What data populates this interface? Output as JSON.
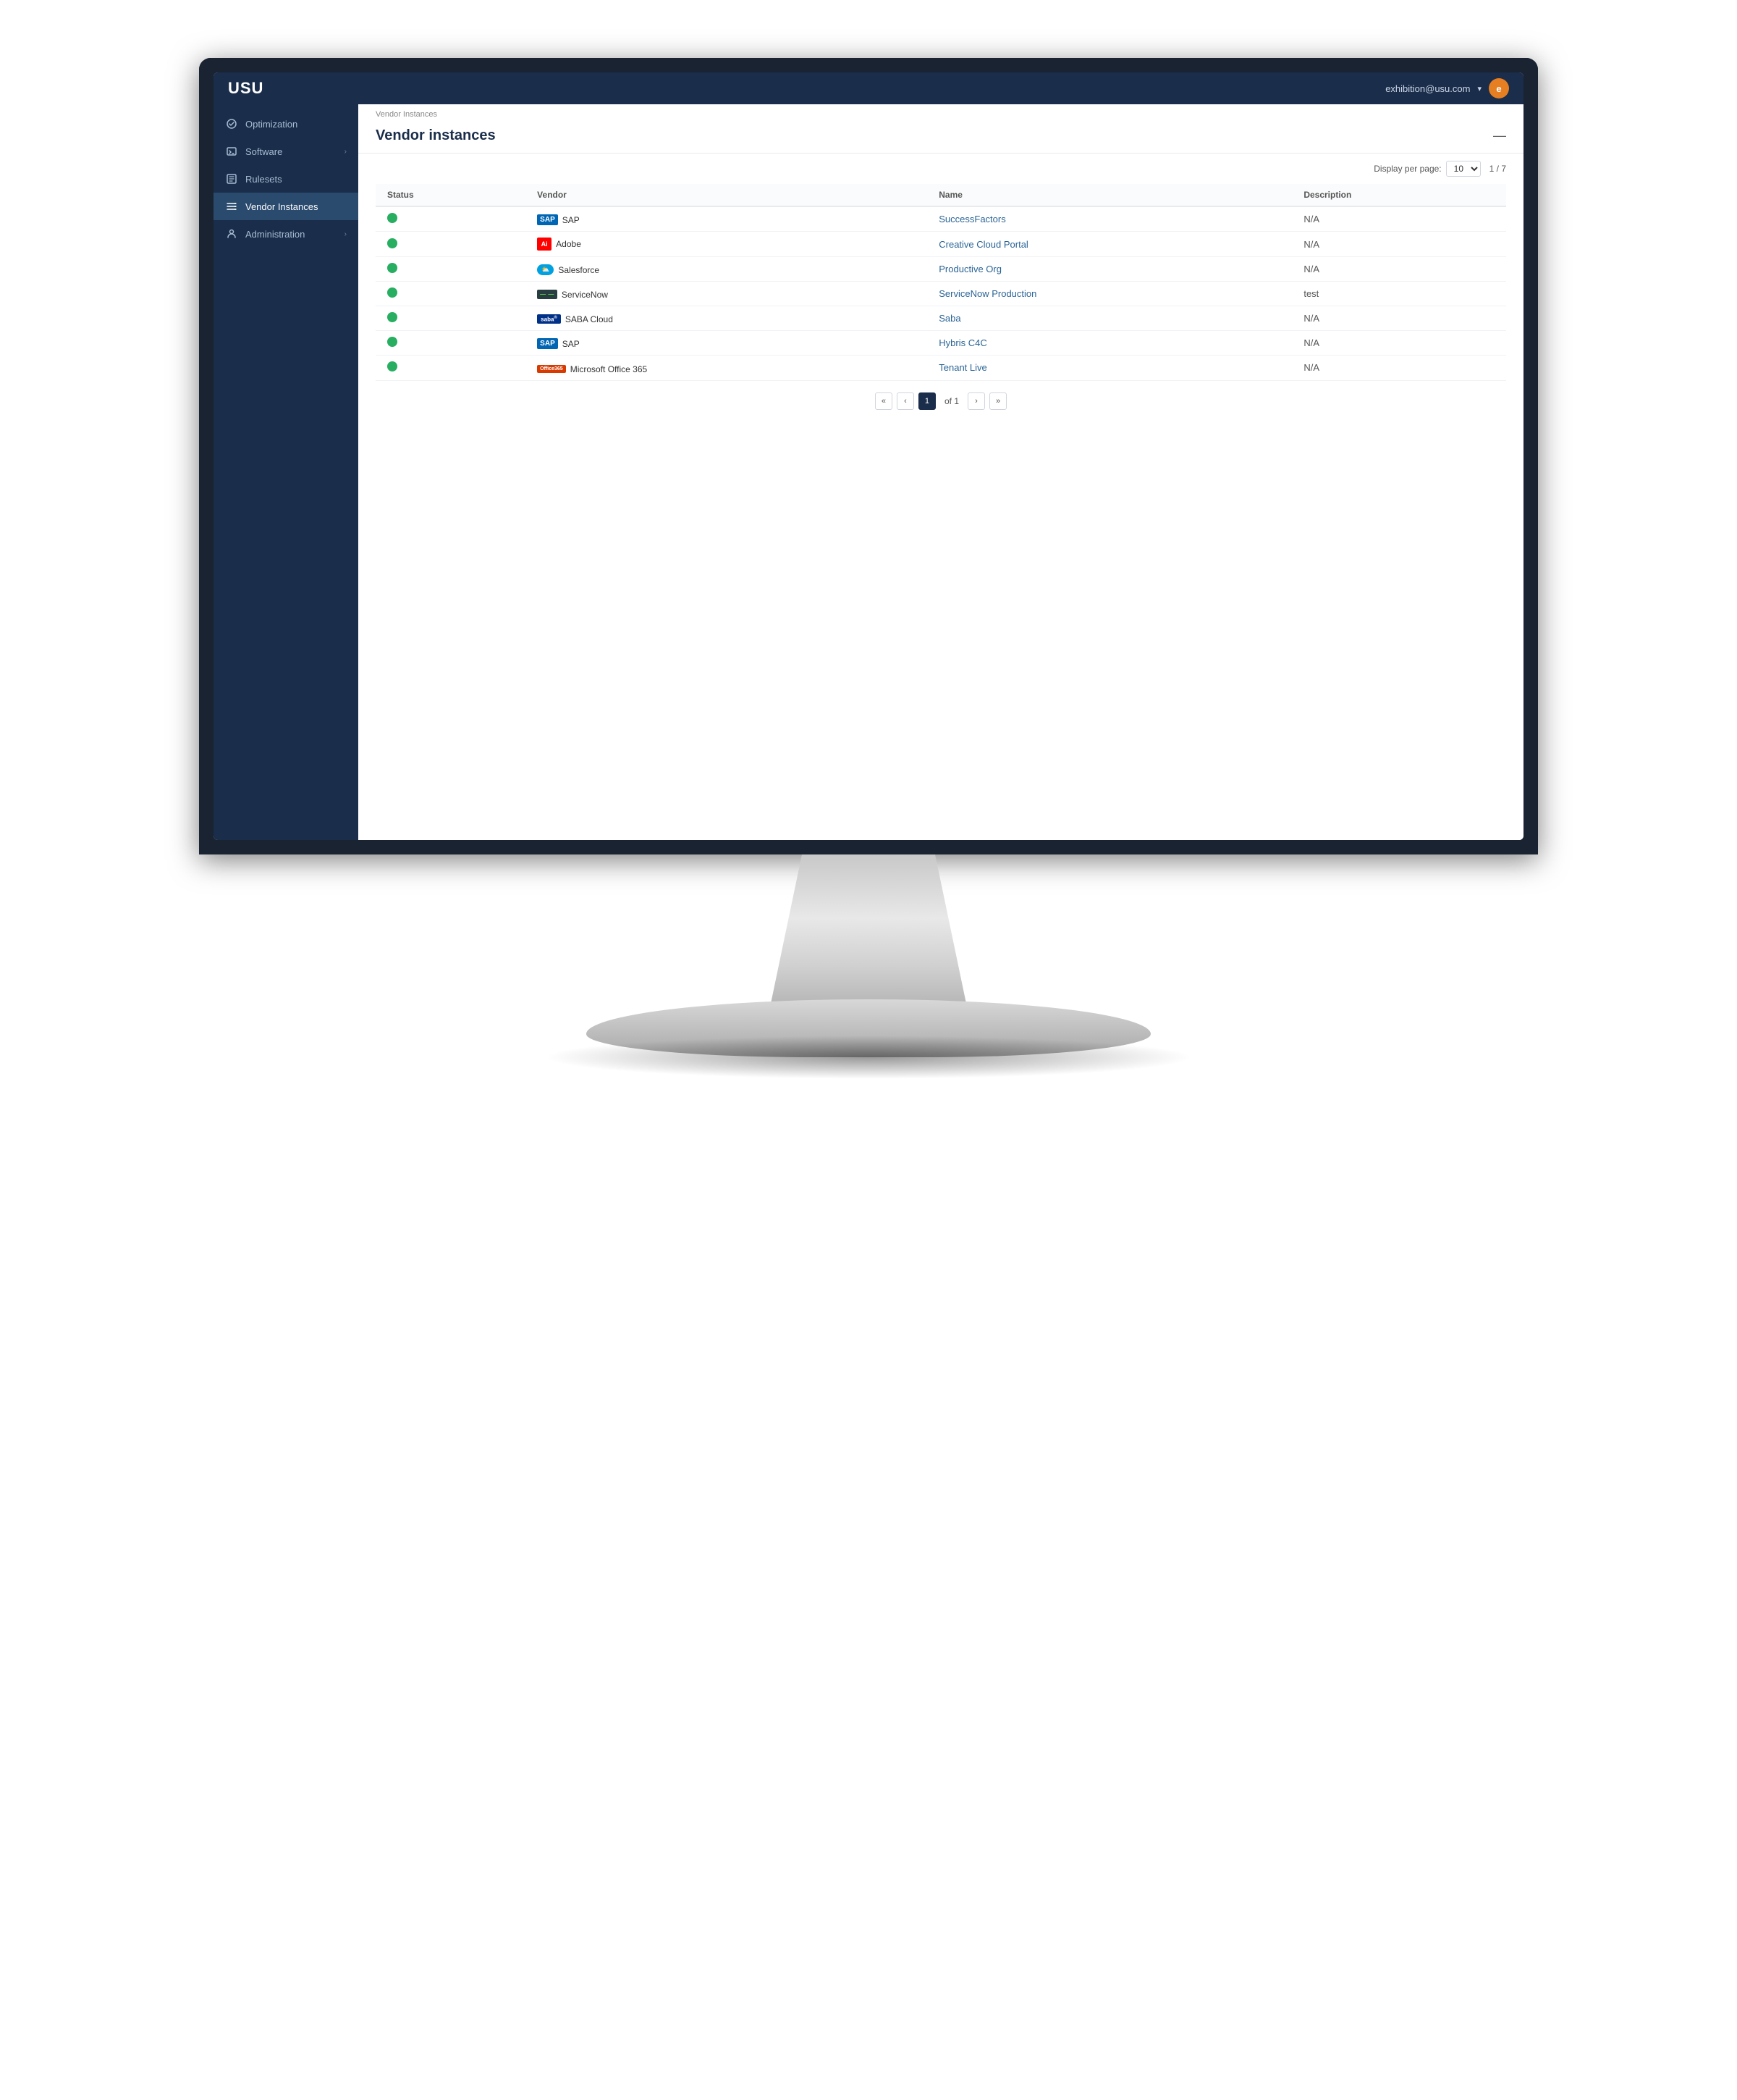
{
  "app": {
    "logo": "USU",
    "nav": {
      "email": "exhibition@usu.com",
      "avatar_initial": "e"
    }
  },
  "sidebar": {
    "items": [
      {
        "id": "optimization",
        "label": "Optimization",
        "icon": "optimization-icon",
        "has_arrow": false,
        "active": false
      },
      {
        "id": "software",
        "label": "Software",
        "icon": "software-icon",
        "has_arrow": true,
        "active": false
      },
      {
        "id": "rulesets",
        "label": "Rulesets",
        "icon": "rulesets-icon",
        "has_arrow": false,
        "active": false
      },
      {
        "id": "vendor-instances",
        "label": "Vendor Instances",
        "icon": "vendor-instances-icon",
        "has_arrow": false,
        "active": true
      },
      {
        "id": "administration",
        "label": "Administration",
        "icon": "administration-icon",
        "has_arrow": true,
        "active": false
      }
    ]
  },
  "page": {
    "breadcrumb": "Vendor Instances",
    "title": "Vendor instances",
    "table": {
      "toolbar": {
        "display_per_page_label": "Display per page:",
        "per_page_value": "10",
        "page_range": "1 / 7"
      },
      "columns": [
        "Status",
        "Vendor",
        "Name",
        "Description"
      ],
      "rows": [
        {
          "id": 1,
          "status": "active",
          "vendor": "SAP",
          "vendor_type": "sap",
          "name": "SuccessFactors",
          "description": "N/A"
        },
        {
          "id": 2,
          "status": "active",
          "vendor": "Adobe",
          "vendor_type": "adobe",
          "name": "Creative Cloud Portal",
          "description": "N/A"
        },
        {
          "id": 3,
          "status": "active",
          "vendor": "Salesforce",
          "vendor_type": "salesforce",
          "name": "Productive Org",
          "description": "N/A"
        },
        {
          "id": 4,
          "status": "active",
          "vendor": "ServiceNow",
          "vendor_type": "servicenow",
          "name": "ServiceNow Production",
          "description": "test"
        },
        {
          "id": 5,
          "status": "active",
          "vendor": "SABA Cloud",
          "vendor_type": "saba",
          "name": "Saba",
          "description": "N/A"
        },
        {
          "id": 6,
          "status": "active",
          "vendor": "SAP",
          "vendor_type": "sap",
          "name": "Hybris C4C",
          "description": "N/A"
        },
        {
          "id": 7,
          "status": "active",
          "vendor": "Microsoft Office 365",
          "vendor_type": "office365",
          "name": "Tenant Live",
          "description": "N/A"
        }
      ]
    },
    "pagination": {
      "current_page": "1",
      "total_pages": "1",
      "page_label": "of 1"
    }
  },
  "colors": {
    "sidebar_bg": "#1a2d4a",
    "active_item_bg": "#2a4a6e",
    "primary": "#1a2d4a",
    "status_active": "#27ae60"
  }
}
